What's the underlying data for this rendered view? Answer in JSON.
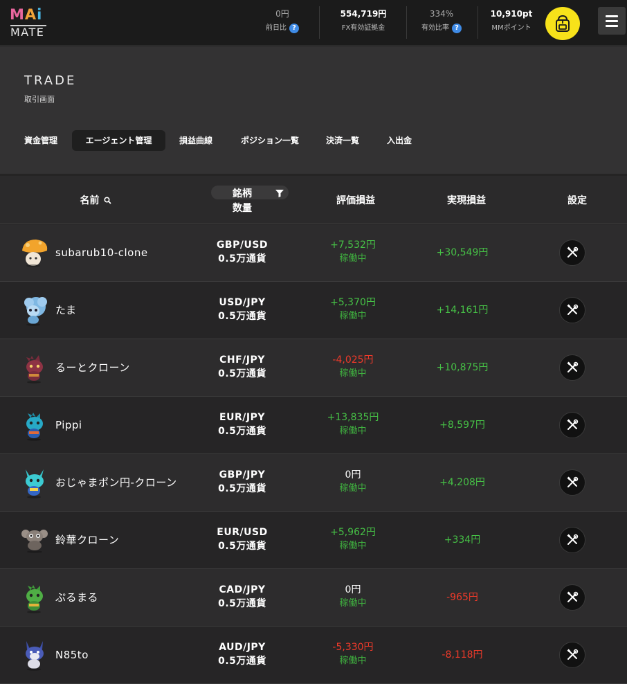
{
  "header": {
    "logo": {
      "top": "MAi",
      "bottom": "MATE"
    },
    "stats": [
      {
        "value": "0円",
        "label": "前日比",
        "help": true
      },
      {
        "value": "554,719円",
        "label": "FX有効証拠金",
        "help": false
      },
      {
        "value": "334%",
        "label": "有効比率",
        "help": true
      },
      {
        "value": "10,910pt",
        "label": "MMポイント",
        "help": false
      }
    ],
    "help_glyph": "?",
    "avatar_icon": "backpack-icon",
    "menu_icon": "hamburger-icon"
  },
  "page": {
    "title": "TRADE",
    "subtitle": "取引画面",
    "tabs": [
      {
        "label": "資金管理",
        "active": false
      },
      {
        "label": "エージェント管理",
        "active": true
      },
      {
        "label": "損益曲線",
        "active": false
      },
      {
        "label": "ポジション一覧",
        "active": false
      },
      {
        "label": "決済一覧",
        "active": false
      },
      {
        "label": "入出金",
        "active": false
      }
    ]
  },
  "table": {
    "columns": {
      "name": "名前",
      "symbol": "銘柄",
      "quantity": "数量",
      "unrealized": "評価損益",
      "realized": "実現損益",
      "settings": "設定"
    },
    "rows": [
      {
        "name": "subarub10-clone",
        "avatar": "mushroom-avatar-icon",
        "pair": "GBP/USD",
        "qty": "0.5万通貨",
        "unrealized": "+7,532円",
        "unrealized_sign": "pos",
        "status": "稼働中",
        "realized": "+30,549円",
        "realized_sign": "pos"
      },
      {
        "name": "たま",
        "avatar": "blue-sheep-avatar-icon",
        "pair": "USD/JPY",
        "qty": "0.5万通貨",
        "unrealized": "+5,370円",
        "unrealized_sign": "pos",
        "status": "稼働中",
        "realized": "+14,161円",
        "realized_sign": "pos"
      },
      {
        "name": "るーとクローン",
        "avatar": "red-dragon-avatar-icon",
        "pair": "CHF/JPY",
        "qty": "0.5万通貨",
        "unrealized": "-4,025円",
        "unrealized_sign": "neg",
        "status": "稼働中",
        "realized": "+10,875円",
        "realized_sign": "pos"
      },
      {
        "name": "Pippi",
        "avatar": "teal-dragon-avatar-icon",
        "pair": "EUR/JPY",
        "qty": "0.5万通貨",
        "unrealized": "+13,835円",
        "unrealized_sign": "pos",
        "status": "稼働中",
        "realized": "+8,597円",
        "realized_sign": "pos"
      },
      {
        "name": "おじゃまポン円-クローン",
        "avatar": "cyan-fox-avatar-icon",
        "pair": "GBP/JPY",
        "qty": "0.5万通貨",
        "unrealized": "0円",
        "unrealized_sign": "zero",
        "status": "稼働中",
        "realized": "+4,208円",
        "realized_sign": "pos"
      },
      {
        "name": "鈴華クローン",
        "avatar": "robot-avatar-icon",
        "pair": "EUR/USD",
        "qty": "0.5万通貨",
        "unrealized": "+5,962円",
        "unrealized_sign": "pos",
        "status": "稼働中",
        "realized": "+334円",
        "realized_sign": "pos"
      },
      {
        "name": "ぷるまる",
        "avatar": "green-dragon-avatar-icon",
        "pair": "CAD/JPY",
        "qty": "0.5万通貨",
        "unrealized": "0円",
        "unrealized_sign": "zero",
        "status": "稼働中",
        "realized": "-965円",
        "realized_sign": "neg"
      },
      {
        "name": "N85to",
        "avatar": "wolf-avatar-icon",
        "pair": "AUD/JPY",
        "qty": "0.5万通貨",
        "unrealized": "-5,330円",
        "unrealized_sign": "neg",
        "status": "稼働中",
        "realized": "-8,118円",
        "realized_sign": "neg"
      }
    ],
    "settings_icon": "tools-icon"
  },
  "colors": {
    "positive": "#46c046",
    "negative": "#ef3a2a",
    "running": "#3fae3f",
    "logo_m": "#e8669e",
    "logo_a": "#f2a23a",
    "logo_i": "#4bb8e6",
    "avatar_bg": "#f7e21a"
  }
}
